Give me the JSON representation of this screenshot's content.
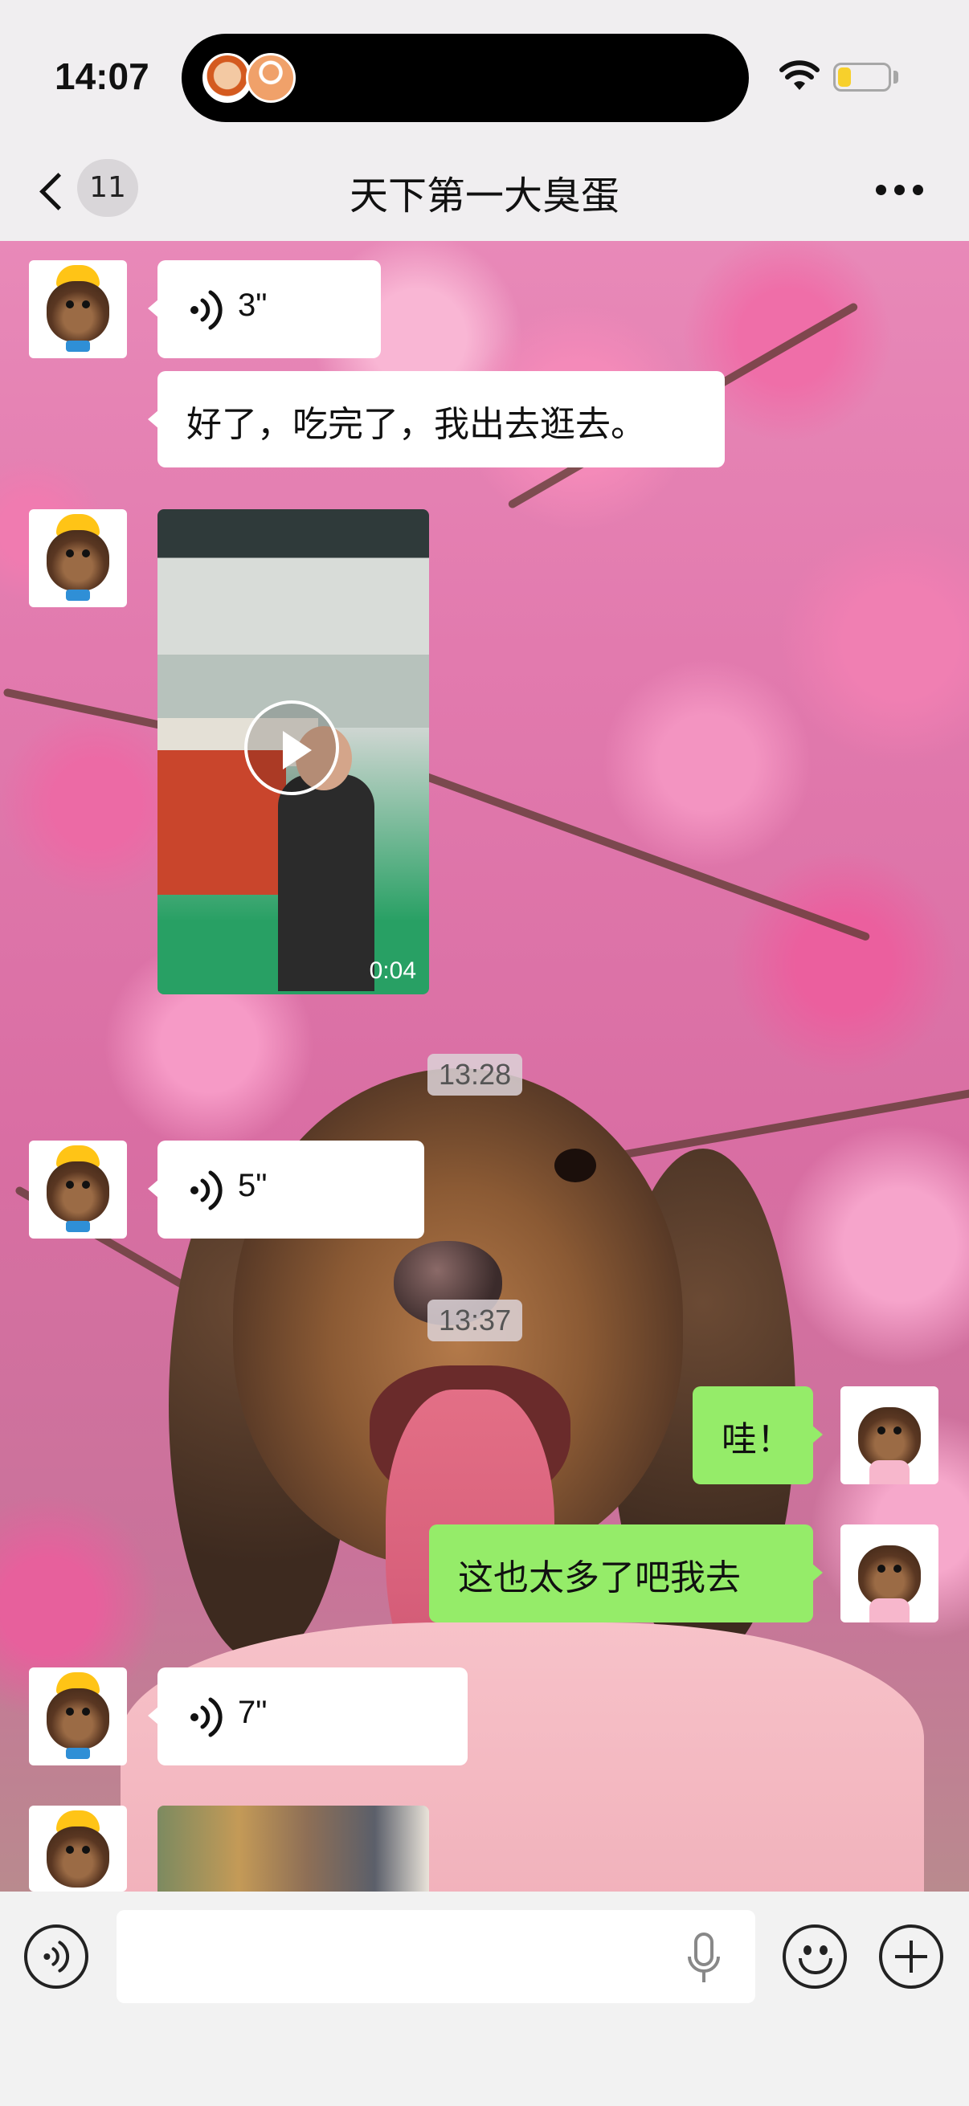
{
  "status_bar": {
    "time": "14:07"
  },
  "nav": {
    "back_count": "11",
    "title": "天下第一大臭蛋"
  },
  "messages": {
    "voice1": "3\"",
    "text1": "好了，吃完了，我出去逛去。",
    "video_duration": "0:04",
    "time1": "13:28",
    "voice2": "5\"",
    "time2": "13:37",
    "mine1": "哇！",
    "mine2": "这也太多了吧我去",
    "voice3": "7\""
  },
  "icons": {
    "back": "chevron-left-icon",
    "more": "more-dots-icon",
    "voice": "voice-wave-icon",
    "play": "play-icon",
    "mic": "microphone-icon",
    "emoji": "emoji-icon",
    "add": "plus-icon",
    "voice_mode": "voice-mode-icon"
  },
  "colors": {
    "sent_bubble": "#95ec69",
    "received_bubble": "#ffffff"
  }
}
